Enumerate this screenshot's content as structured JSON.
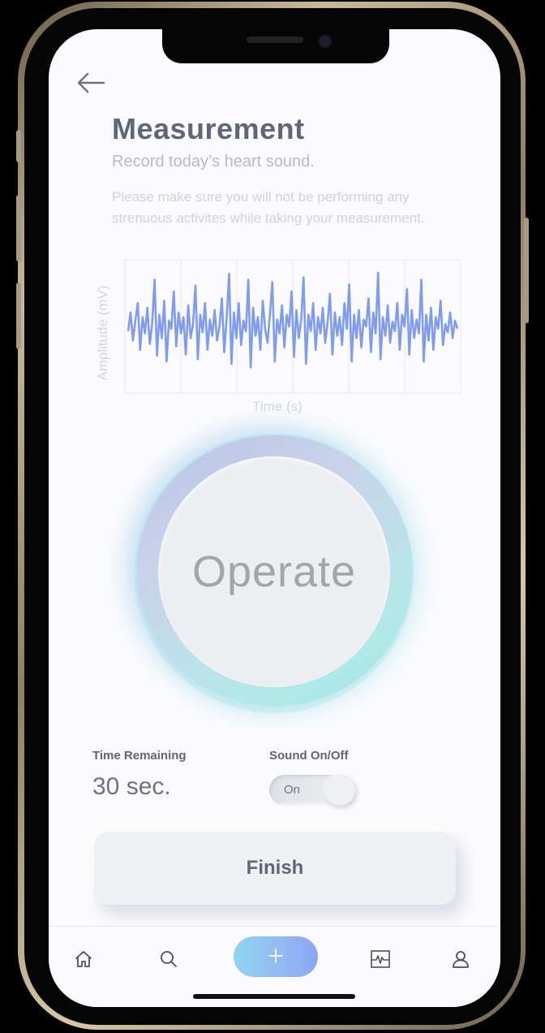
{
  "header": {
    "back_icon": "arrow-left-icon",
    "title": "Measurement",
    "subtitle": "Record today’s heart sound.",
    "note": "Please make sure you will not be performing any strenuous activites while taking your measurement."
  },
  "chart_data": {
    "type": "line",
    "xlabel": "Time (s)",
    "ylabel": "Amplitude (mV)",
    "grid": true,
    "series": [
      {
        "color": "#7f9cf0",
        "values": [
          0.46,
          0.62,
          0.38,
          0.55,
          0.7,
          0.3,
          0.58,
          0.44,
          0.66,
          0.35,
          0.52,
          0.9,
          0.25,
          0.6,
          0.4,
          0.72,
          0.2,
          0.55,
          0.48,
          0.8,
          0.33,
          0.62,
          0.44,
          0.58,
          0.26,
          0.68,
          0.4,
          0.52,
          0.85,
          0.22,
          0.6,
          0.45,
          0.7,
          0.3,
          0.56,
          0.42,
          0.64,
          0.38,
          0.5,
          0.74,
          0.28,
          0.58,
          0.95,
          0.18,
          0.62,
          0.4,
          0.7,
          0.34,
          0.55,
          0.46,
          0.9,
          0.15,
          0.66,
          0.42,
          0.58,
          0.3,
          0.72,
          0.48,
          0.36,
          0.6,
          0.88,
          0.2,
          0.56,
          0.44,
          0.68,
          0.32,
          0.6,
          0.5,
          0.8,
          0.24,
          0.64,
          0.4,
          0.56,
          0.92,
          0.18,
          0.6,
          0.46,
          0.7,
          0.3,
          0.58,
          0.44,
          0.66,
          0.36,
          0.54,
          0.78,
          0.26,
          0.62,
          0.42,
          0.58,
          0.34,
          0.7,
          0.48,
          0.86,
          0.2,
          0.6,
          0.4,
          0.64,
          0.32,
          0.56,
          0.5,
          0.74,
          0.28,
          0.62,
          0.44,
          0.96,
          0.22,
          0.58,
          0.42,
          0.68,
          0.36,
          0.54,
          0.46,
          0.7,
          0.3,
          0.6,
          0.5,
          0.82,
          0.26,
          0.64,
          0.4,
          0.56,
          0.44,
          0.9,
          0.2,
          0.6,
          0.38,
          0.66,
          0.3,
          0.58,
          0.48,
          0.72,
          0.34,
          0.52,
          0.45,
          0.62,
          0.4,
          0.55,
          0.48
        ]
      }
    ]
  },
  "operate": {
    "label": "Operate"
  },
  "timer": {
    "label": "Time Remaining",
    "value": "30 sec."
  },
  "sound": {
    "label": "Sound On/Off",
    "state_label": "On",
    "on": true
  },
  "finish": {
    "label": "Finish"
  },
  "tabbar": {
    "items": [
      {
        "icon": "home-icon"
      },
      {
        "icon": "search-icon"
      },
      {
        "icon": "plus-icon"
      },
      {
        "icon": "heart-monitor-icon"
      },
      {
        "icon": "user-icon"
      }
    ]
  },
  "colors": {
    "accent_gradient_start": "#8fd6ee",
    "accent_gradient_end": "#8ea4f4",
    "waveform": "#7f9cf0",
    "title": "#5f6677"
  }
}
